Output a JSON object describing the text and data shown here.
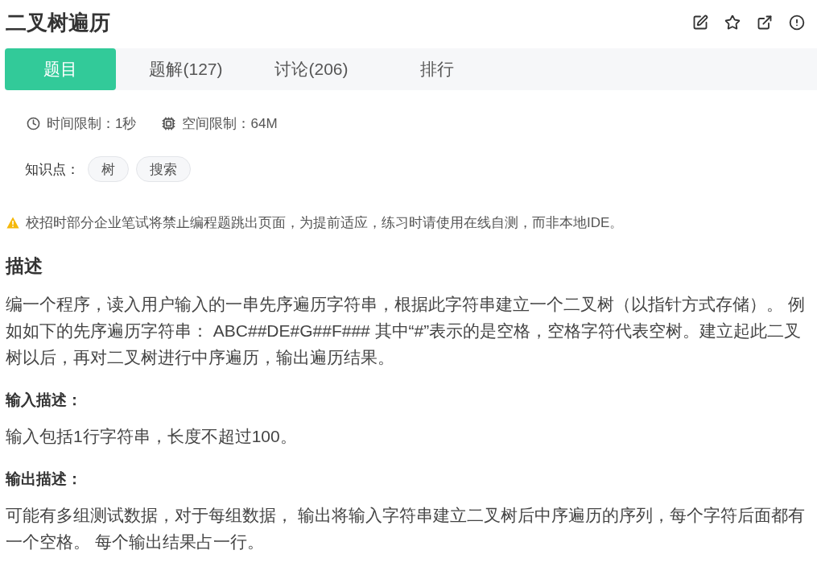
{
  "title": "二叉树遍历",
  "tabs": [
    {
      "label": "题目",
      "selected": true
    },
    {
      "label": "题解(127)",
      "selected": false
    },
    {
      "label": "讨论(206)",
      "selected": false
    },
    {
      "label": "排行",
      "selected": false
    }
  ],
  "limits": [
    {
      "kind": "time",
      "text": "时间限制：1秒"
    },
    {
      "kind": "memory",
      "text": "空间限制：64M"
    }
  ],
  "knowledge": {
    "label": "知识点：",
    "tags": [
      "树",
      "搜索"
    ]
  },
  "notice": "校招时部分企业笔试将禁止编程题跳出页面，为提前适应，练习时请使用在线自测，而非本地IDE。",
  "sections": [
    {
      "kind": "main",
      "heading": "描述",
      "text": "编一个程序，读入用户输入的一串先序遍历字符串，根据此字符串建立一个二叉树（以指针方式存储）。 例如如下的先序遍历字符串： ABC##DE#G##F### 其中“#”表示的是空格，空格字符代表空树。建立起此二叉树以后，再对二叉树进行中序遍历，输出遍历结果。"
    },
    {
      "kind": "sub",
      "heading": "输入描述：",
      "text": "输入包括1行字符串，长度不超过100。"
    },
    {
      "kind": "sub",
      "heading": "输出描述：",
      "text": "可能有多组测试数据，对于每组数据， 输出将输入字符串建立二叉树后中序遍历的序列，每个字符后面都有一个空格。 每个输出结果占一行。"
    }
  ]
}
